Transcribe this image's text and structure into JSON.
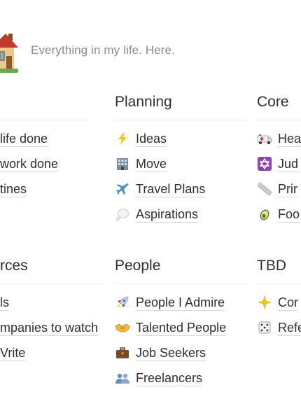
{
  "subtitle": "Everything in my life. Here.",
  "sections": {
    "col1_top": {
      "title": "",
      "items": [
        {
          "label": "life done",
          "icon": "none"
        },
        {
          "label": "work done",
          "icon": "none"
        },
        {
          "label": "tines",
          "icon": "none"
        }
      ]
    },
    "planning": {
      "title": "Planning",
      "items": [
        {
          "label": "Ideas",
          "icon": "lightning-icon"
        },
        {
          "label": "Move",
          "icon": "office-building-icon"
        },
        {
          "label": "Travel Plans",
          "icon": "airplane-icon"
        },
        {
          "label": "Aspirations",
          "icon": "thought-bubble-icon"
        }
      ]
    },
    "core": {
      "title": "Core",
      "items": [
        {
          "label": "Hea",
          "icon": "ambulance-icon"
        },
        {
          "label": "Jud",
          "icon": "star-of-david-icon"
        },
        {
          "label": "Prir",
          "icon": "ruler-icon"
        },
        {
          "label": "Foo",
          "icon": "avocado-icon"
        }
      ]
    },
    "resources": {
      "title": "rces",
      "items": [
        {
          "label": "ls",
          "icon": "none"
        },
        {
          "label": "mpanies to watch",
          "icon": "none"
        },
        {
          "label": "Vrite",
          "icon": "none"
        }
      ]
    },
    "people": {
      "title": "People",
      "items": [
        {
          "label": "People I Admire",
          "icon": "rocket-icon"
        },
        {
          "label": "Talented People",
          "icon": "handshake-icon"
        },
        {
          "label": "Job Seekers",
          "icon": "briefcase-icon"
        },
        {
          "label": "Freelancers",
          "icon": "people-silhouettes-icon"
        }
      ]
    },
    "tbd": {
      "title": "TBD",
      "items": [
        {
          "label": "Cor",
          "icon": "sparkle-star-icon"
        },
        {
          "label": "Refe",
          "icon": "dice-icon"
        }
      ]
    }
  },
  "colors": {
    "text": "#2f2f2f",
    "muted": "#8b8b88",
    "divider": "#ececea",
    "underline": "#d8d7d4"
  }
}
